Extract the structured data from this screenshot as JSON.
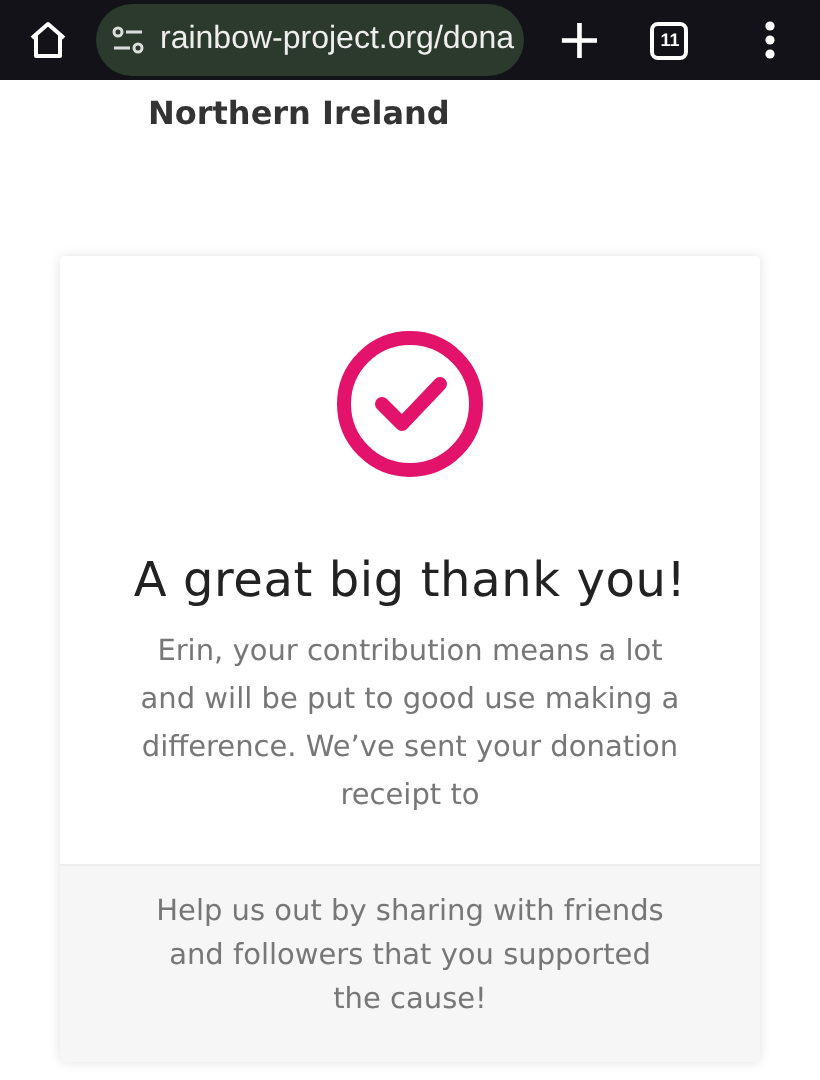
{
  "browser": {
    "url": "rainbow-project.org/dona",
    "tab_count": "11",
    "plus": "+"
  },
  "page": {
    "org_line": "Northern Ireland"
  },
  "card": {
    "title": "A great big thank you!",
    "message": "Erin, your contribution means a lot and will be put to good use making a difference. We’ve sent your donation receipt to",
    "share_text": "Help us out by sharing with friends and followers that you supported the cause!"
  }
}
